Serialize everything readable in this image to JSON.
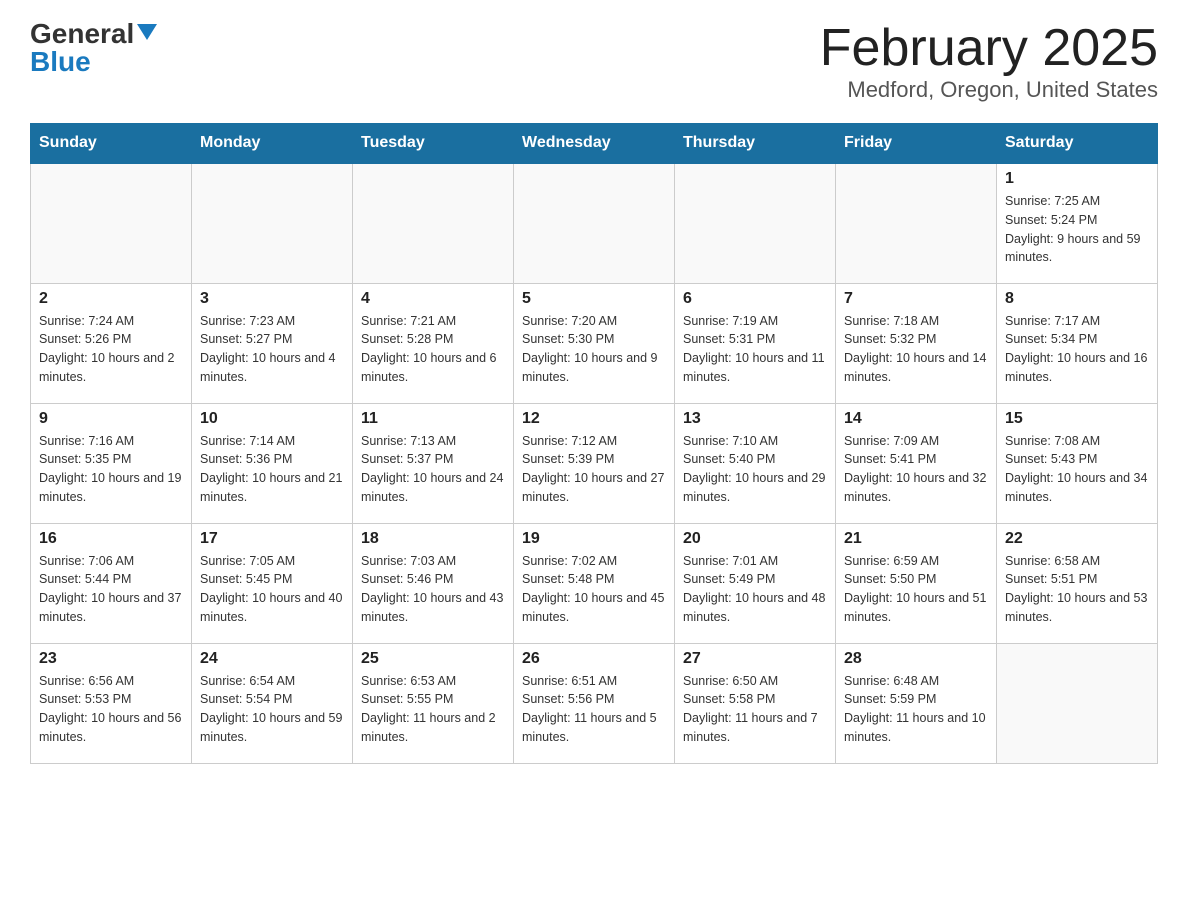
{
  "header": {
    "logo_general": "General",
    "logo_blue": "Blue",
    "month_title": "February 2025",
    "location": "Medford, Oregon, United States"
  },
  "days_of_week": [
    "Sunday",
    "Monday",
    "Tuesday",
    "Wednesday",
    "Thursday",
    "Friday",
    "Saturday"
  ],
  "weeks": [
    [
      {
        "day": "",
        "info": ""
      },
      {
        "day": "",
        "info": ""
      },
      {
        "day": "",
        "info": ""
      },
      {
        "day": "",
        "info": ""
      },
      {
        "day": "",
        "info": ""
      },
      {
        "day": "",
        "info": ""
      },
      {
        "day": "1",
        "info": "Sunrise: 7:25 AM\nSunset: 5:24 PM\nDaylight: 9 hours and 59 minutes."
      }
    ],
    [
      {
        "day": "2",
        "info": "Sunrise: 7:24 AM\nSunset: 5:26 PM\nDaylight: 10 hours and 2 minutes."
      },
      {
        "day": "3",
        "info": "Sunrise: 7:23 AM\nSunset: 5:27 PM\nDaylight: 10 hours and 4 minutes."
      },
      {
        "day": "4",
        "info": "Sunrise: 7:21 AM\nSunset: 5:28 PM\nDaylight: 10 hours and 6 minutes."
      },
      {
        "day": "5",
        "info": "Sunrise: 7:20 AM\nSunset: 5:30 PM\nDaylight: 10 hours and 9 minutes."
      },
      {
        "day": "6",
        "info": "Sunrise: 7:19 AM\nSunset: 5:31 PM\nDaylight: 10 hours and 11 minutes."
      },
      {
        "day": "7",
        "info": "Sunrise: 7:18 AM\nSunset: 5:32 PM\nDaylight: 10 hours and 14 minutes."
      },
      {
        "day": "8",
        "info": "Sunrise: 7:17 AM\nSunset: 5:34 PM\nDaylight: 10 hours and 16 minutes."
      }
    ],
    [
      {
        "day": "9",
        "info": "Sunrise: 7:16 AM\nSunset: 5:35 PM\nDaylight: 10 hours and 19 minutes."
      },
      {
        "day": "10",
        "info": "Sunrise: 7:14 AM\nSunset: 5:36 PM\nDaylight: 10 hours and 21 minutes."
      },
      {
        "day": "11",
        "info": "Sunrise: 7:13 AM\nSunset: 5:37 PM\nDaylight: 10 hours and 24 minutes."
      },
      {
        "day": "12",
        "info": "Sunrise: 7:12 AM\nSunset: 5:39 PM\nDaylight: 10 hours and 27 minutes."
      },
      {
        "day": "13",
        "info": "Sunrise: 7:10 AM\nSunset: 5:40 PM\nDaylight: 10 hours and 29 minutes."
      },
      {
        "day": "14",
        "info": "Sunrise: 7:09 AM\nSunset: 5:41 PM\nDaylight: 10 hours and 32 minutes."
      },
      {
        "day": "15",
        "info": "Sunrise: 7:08 AM\nSunset: 5:43 PM\nDaylight: 10 hours and 34 minutes."
      }
    ],
    [
      {
        "day": "16",
        "info": "Sunrise: 7:06 AM\nSunset: 5:44 PM\nDaylight: 10 hours and 37 minutes."
      },
      {
        "day": "17",
        "info": "Sunrise: 7:05 AM\nSunset: 5:45 PM\nDaylight: 10 hours and 40 minutes."
      },
      {
        "day": "18",
        "info": "Sunrise: 7:03 AM\nSunset: 5:46 PM\nDaylight: 10 hours and 43 minutes."
      },
      {
        "day": "19",
        "info": "Sunrise: 7:02 AM\nSunset: 5:48 PM\nDaylight: 10 hours and 45 minutes."
      },
      {
        "day": "20",
        "info": "Sunrise: 7:01 AM\nSunset: 5:49 PM\nDaylight: 10 hours and 48 minutes."
      },
      {
        "day": "21",
        "info": "Sunrise: 6:59 AM\nSunset: 5:50 PM\nDaylight: 10 hours and 51 minutes."
      },
      {
        "day": "22",
        "info": "Sunrise: 6:58 AM\nSunset: 5:51 PM\nDaylight: 10 hours and 53 minutes."
      }
    ],
    [
      {
        "day": "23",
        "info": "Sunrise: 6:56 AM\nSunset: 5:53 PM\nDaylight: 10 hours and 56 minutes."
      },
      {
        "day": "24",
        "info": "Sunrise: 6:54 AM\nSunset: 5:54 PM\nDaylight: 10 hours and 59 minutes."
      },
      {
        "day": "25",
        "info": "Sunrise: 6:53 AM\nSunset: 5:55 PM\nDaylight: 11 hours and 2 minutes."
      },
      {
        "day": "26",
        "info": "Sunrise: 6:51 AM\nSunset: 5:56 PM\nDaylight: 11 hours and 5 minutes."
      },
      {
        "day": "27",
        "info": "Sunrise: 6:50 AM\nSunset: 5:58 PM\nDaylight: 11 hours and 7 minutes."
      },
      {
        "day": "28",
        "info": "Sunrise: 6:48 AM\nSunset: 5:59 PM\nDaylight: 11 hours and 10 minutes."
      },
      {
        "day": "",
        "info": ""
      }
    ]
  ]
}
